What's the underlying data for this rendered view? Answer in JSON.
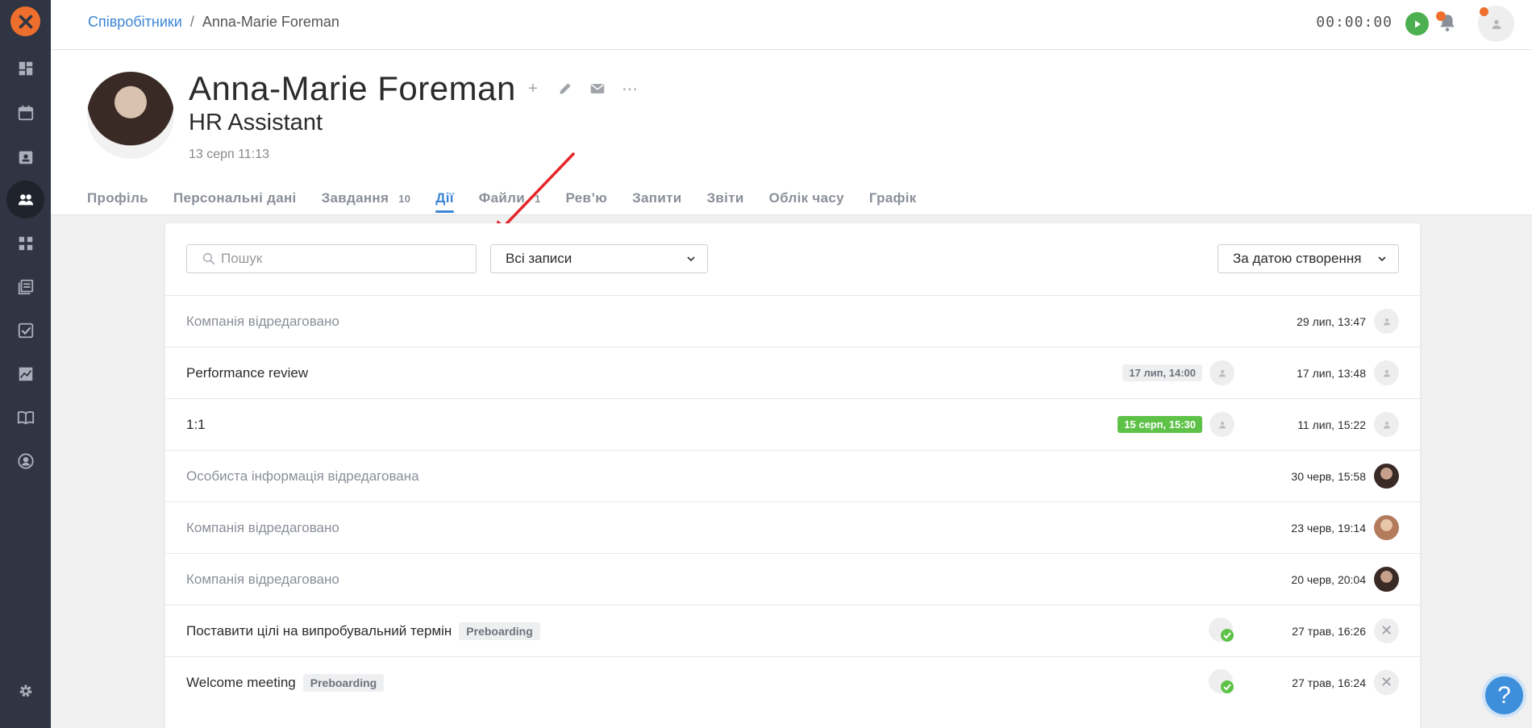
{
  "breadcrumb": {
    "parent": "Співробітники",
    "separator": "/",
    "current": "Anna-Marie Foreman"
  },
  "timer": "00:00:00",
  "profile": {
    "name": "Anna-Marie Foreman",
    "job_title": "HR Assistant",
    "date": "13 серп 11:13"
  },
  "tabs": [
    {
      "label": "Профіль",
      "count": ""
    },
    {
      "label": "Персональні дані",
      "count": ""
    },
    {
      "label": "Завдання",
      "count": "10"
    },
    {
      "label": "Дії",
      "count": "",
      "active": true
    },
    {
      "label": "Файли",
      "count": "1"
    },
    {
      "label": "Рев’ю",
      "count": ""
    },
    {
      "label": "Запити",
      "count": ""
    },
    {
      "label": "Звіти",
      "count": ""
    },
    {
      "label": "Облік часу",
      "count": ""
    },
    {
      "label": "Графік",
      "count": ""
    }
  ],
  "search": {
    "placeholder": "Пошук"
  },
  "filter": {
    "selected": "Всі записи"
  },
  "sort": {
    "selected": "За датою створення"
  },
  "activities": [
    {
      "title": "Компанія відредаговано",
      "muted": true,
      "tag": "",
      "due": "",
      "time": "29 лип, 13:47"
    },
    {
      "title": "Performance review",
      "muted": false,
      "tag": "",
      "due": "17 лип, 14:00",
      "time": "17 лип, 13:48"
    },
    {
      "title": "1:1",
      "muted": false,
      "tag": "",
      "due": "15 серп, 15:30",
      "time": "11 лип, 15:22"
    },
    {
      "title": "Особиста інформація відредагована",
      "muted": true,
      "tag": "",
      "due": "",
      "time": "30 черв, 15:58"
    },
    {
      "title": "Компанія відредаговано",
      "muted": true,
      "tag": "",
      "due": "",
      "time": "23 черв, 19:14"
    },
    {
      "title": "Компанія відредаговано",
      "muted": true,
      "tag": "",
      "due": "",
      "time": "20 черв, 20:04"
    },
    {
      "title": "Поставити цілі на випробувальний термін",
      "muted": false,
      "tag": "Preboarding",
      "due": "",
      "time": "27 трав, 16:26"
    },
    {
      "title": "Welcome meeting",
      "muted": false,
      "tag": "Preboarding",
      "due": "",
      "time": "27 трав, 16:24"
    }
  ],
  "colors": {
    "accent": "#3d86d6",
    "brand": "#ee6f2d",
    "sidebar": "#2f3542",
    "success": "#5ec248"
  }
}
